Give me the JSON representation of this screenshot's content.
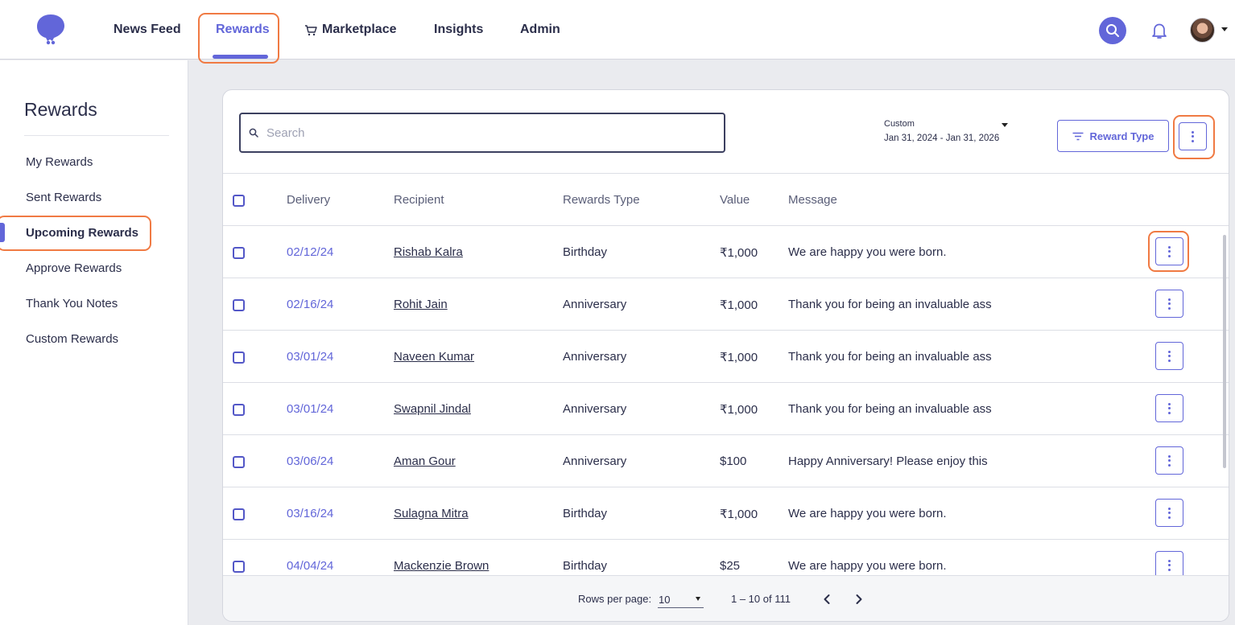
{
  "nav": {
    "items": [
      "News Feed",
      "Rewards",
      "Marketplace",
      "Insights",
      "Admin"
    ],
    "active": "Rewards"
  },
  "sidebar": {
    "title": "Rewards",
    "items": [
      "My Rewards",
      "Sent Rewards",
      "Upcoming Rewards",
      "Approve Rewards",
      "Thank You Notes",
      "Custom Rewards"
    ],
    "active": "Upcoming Rewards"
  },
  "toolbar": {
    "search_placeholder": "Search",
    "date_label": "Custom",
    "date_range": "Jan 31, 2024 - Jan 31, 2026",
    "reward_type_label": "Reward Type"
  },
  "table": {
    "columns": [
      "Delivery",
      "Recipient",
      "Rewards Type",
      "Value",
      "Message"
    ],
    "rows": [
      {
        "delivery": "02/12/24",
        "recipient": "Rishab Kalra",
        "type": "Birthday",
        "value": "₹1,000",
        "message": "We are happy you were born."
      },
      {
        "delivery": "02/16/24",
        "recipient": "Rohit Jain",
        "type": "Anniversary",
        "value": "₹1,000",
        "message": "Thank you for being an invaluable ass"
      },
      {
        "delivery": "03/01/24",
        "recipient": "Naveen Kumar",
        "type": "Anniversary",
        "value": "₹1,000",
        "message": "Thank you for being an invaluable ass"
      },
      {
        "delivery": "03/01/24",
        "recipient": "Swapnil Jindal",
        "type": "Anniversary",
        "value": "₹1,000",
        "message": "Thank you for being an invaluable ass"
      },
      {
        "delivery": "03/06/24",
        "recipient": "Aman Gour",
        "type": "Anniversary",
        "value": "$100",
        "message": "Happy Anniversary! Please enjoy this"
      },
      {
        "delivery": "03/16/24",
        "recipient": "Sulagna Mitra",
        "type": "Birthday",
        "value": "₹1,000",
        "message": "We are happy you were born."
      },
      {
        "delivery": "04/04/24",
        "recipient": "Mackenzie Brown",
        "type": "Birthday",
        "value": "$25",
        "message": "We are happy you were born."
      }
    ]
  },
  "pagination": {
    "rows_per_page_label": "Rows per page:",
    "rows_per_page": "10",
    "range": "1 – 10 of 111"
  },
  "colors": {
    "accent": "#6266d9",
    "highlight": "#f07a43",
    "text": "#2b2e4a"
  },
  "icons": [
    "logo-icon",
    "cart-icon",
    "search-icon",
    "bell-icon",
    "avatar",
    "filter-icon",
    "kebab-menu-icon",
    "chevron-left-icon",
    "chevron-right-icon"
  ]
}
